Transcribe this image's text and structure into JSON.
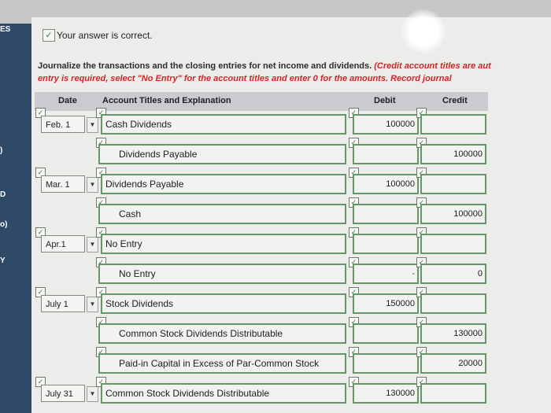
{
  "sidebar": {
    "labels": [
      "ES",
      ")",
      "D",
      "o)",
      "Y"
    ]
  },
  "status": {
    "check": "✓",
    "text": "Your answer is correct."
  },
  "instructions": {
    "line1_dark": "Journalize the transactions and the closing entries for net income and dividends.",
    "line1_red": "(Credit account titles are aut",
    "line2_red": "entry is required, select \"No Entry\" for the account titles and enter 0 for the amounts. Record journal"
  },
  "table": {
    "headers": {
      "date": "Date",
      "account": "Account Titles and Explanation",
      "debit": "Debit",
      "credit": "Credit"
    },
    "rows": [
      {
        "date": "Feb. 1",
        "account": "Cash Dividends",
        "debit": "100000",
        "credit": ""
      },
      {
        "date": "",
        "account": "Dividends Payable",
        "debit": "",
        "credit": "100000"
      },
      {
        "date": "Mar. 1",
        "account": "Dividends Payable",
        "debit": "100000",
        "credit": ""
      },
      {
        "date": "",
        "account": "Cash",
        "debit": "",
        "credit": "100000"
      },
      {
        "date": "Apr.1",
        "account": "No Entry",
        "debit": "",
        "credit": ""
      },
      {
        "date": "",
        "account": "No Entry",
        "debit": "-",
        "credit": "0"
      },
      {
        "date": "July 1",
        "account": "Stock Dividends",
        "debit": "150000",
        "credit": ""
      },
      {
        "date": "",
        "account": "Common Stock Dividends Distributable",
        "debit": "",
        "credit": "130000"
      },
      {
        "date": "",
        "account": "Paid-in Capital in Excess of Par-Common Stock",
        "debit": "",
        "credit": "20000"
      },
      {
        "date": "July 31",
        "account": "Common Stock Dividends Distributable",
        "debit": "130000",
        "credit": ""
      }
    ]
  },
  "icons": {
    "check": "✓",
    "dropdown": "▼"
  }
}
